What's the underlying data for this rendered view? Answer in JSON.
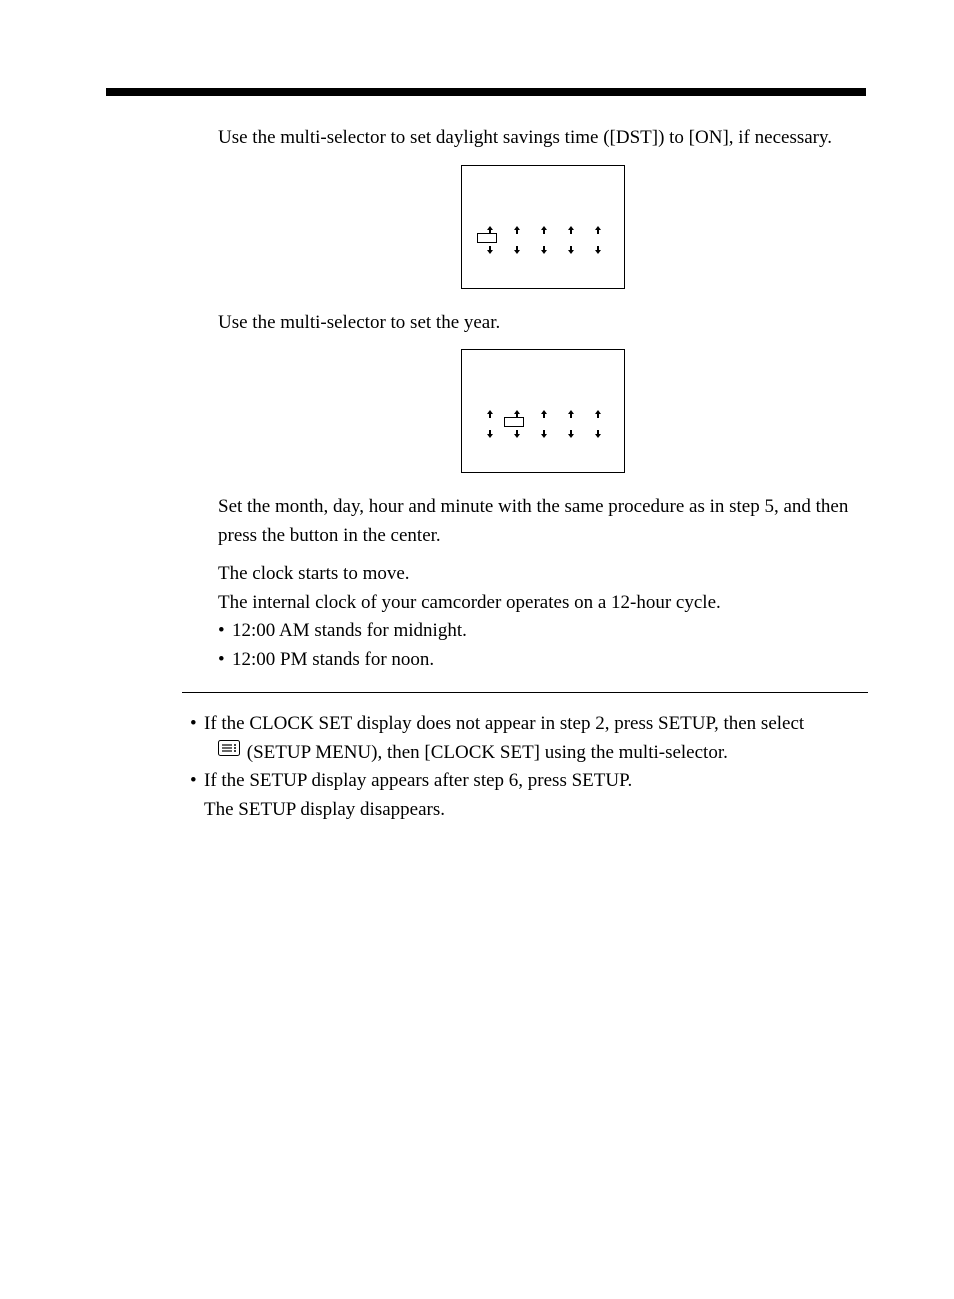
{
  "step4_text": "Use the multi-selector to set daylight savings time ([DST]) to [ON],  if necessary.",
  "step5_text": "Use the multi-selector to set the year.",
  "step6": {
    "text1": "Set the month, day, hour and minute with the same procedure as in step 5, and then press the button in the center.",
    "text2": "The clock starts to move.",
    "text3": "The internal clock of your camcorder operates on a 12-hour cycle.",
    "bullets": [
      "12:00 AM stands for midnight.",
      "12:00 PM stands for noon."
    ]
  },
  "notes": {
    "b1_part1": "If the CLOCK SET display does not appear in step 2, press SETUP, then select",
    "b1_part2": "(SETUP MENU), then [CLOCK SET] using the multi-selector.",
    "b2_line1": "If the SETUP display appears after step 6, press SETUP.",
    "b2_line2": "The SETUP display disappears."
  },
  "glyphs": {
    "bullet": "•"
  }
}
